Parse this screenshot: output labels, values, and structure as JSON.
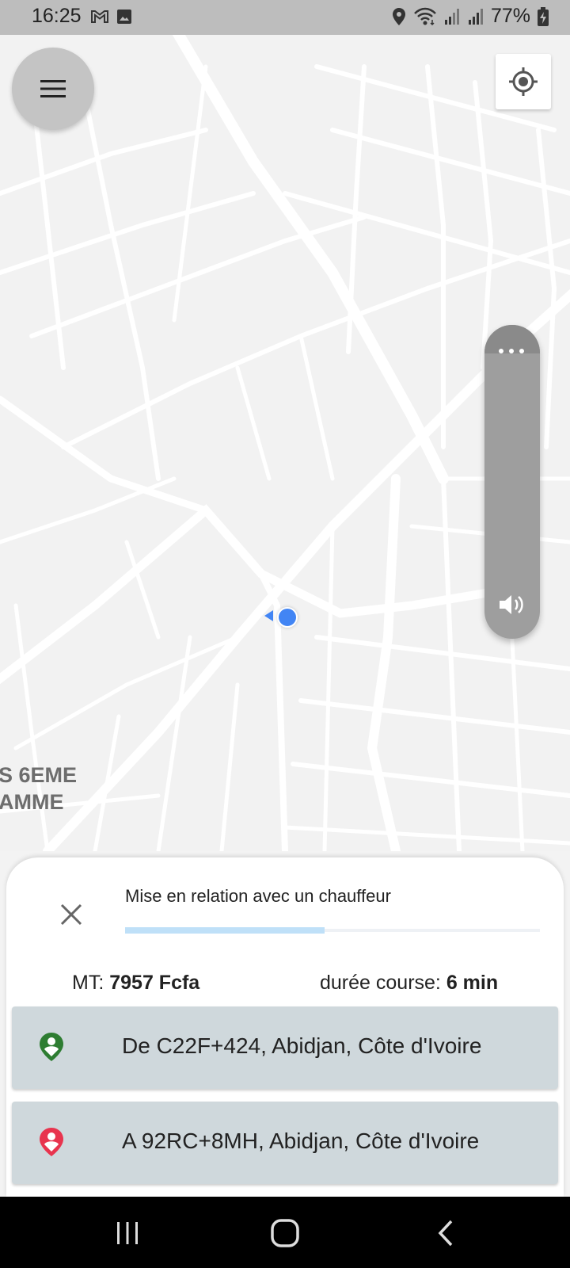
{
  "status_bar": {
    "time": "16:25",
    "battery": "77%",
    "icons": [
      "gmail-icon",
      "image-icon",
      "location-icon",
      "wifi-icon",
      "signal-icon",
      "signal-icon",
      "battery-charging-icon"
    ]
  },
  "map": {
    "labels": {
      "line1": "S 6EME",
      "line2": "AMME"
    },
    "colors": {
      "background": "#f2f2f2",
      "roads": "#ffffff",
      "location": "#4285f4"
    }
  },
  "controls": {
    "menu_icon": "hamburger-icon",
    "locate_icon": "my-location-icon",
    "volume_icon": "volume-icon"
  },
  "sheet": {
    "status_text": "Mise en relation avec un chauffeur",
    "progress_fraction": 0.48,
    "fare_label": "MT:",
    "fare_value": "7957 Fcfa",
    "duration_label": "durée course:",
    "duration_value": "6 min",
    "from_address": "De C22F+424, Abidjan, Côte d'Ivoire",
    "to_address": "A 92RC+8MH, Abidjan, Côte d'Ivoire",
    "colors": {
      "from_pin": "#2e7d32",
      "to_pin": "#e8344e",
      "card": "#cfd8dc",
      "progress": "#bfe0f8"
    }
  },
  "nav_bar": {
    "buttons": [
      "recents-icon",
      "home-icon",
      "back-icon"
    ]
  }
}
